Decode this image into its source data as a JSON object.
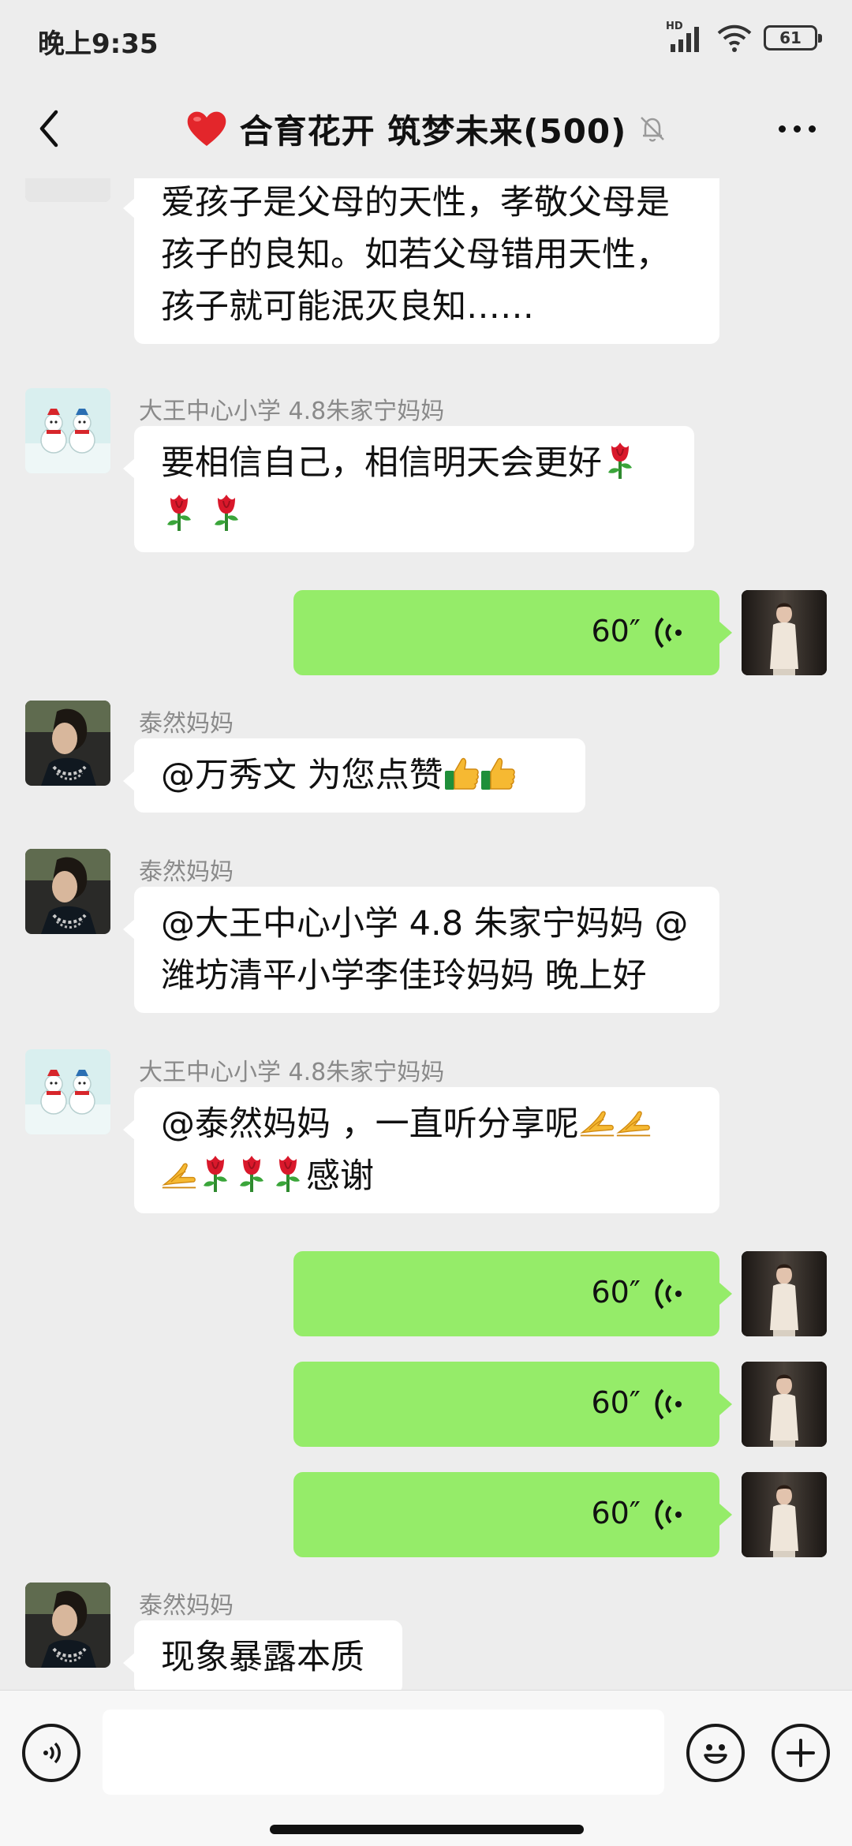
{
  "status_bar": {
    "time": "晚上9:35",
    "network": "HD",
    "battery": "61",
    "icons": [
      "signal-icon",
      "wifi-icon",
      "battery-icon"
    ]
  },
  "header": {
    "title": "合育花开 筑梦未来(500)",
    "title_emoji": "red-heart",
    "muted": true
  },
  "senders": {
    "a": "大王中心小学 4.8朱家宁妈妈",
    "b": "泰然妈妈"
  },
  "messages": [
    {
      "direction": "in",
      "lines": [
        "爱孩子是父母的天性，孝敬父母是",
        "孩子的良知。如若父母错用天性，",
        "孩子就可能泯灭良知……"
      ]
    },
    {
      "direction": "in",
      "sender": "大王中心小学 4.8朱家宁妈妈",
      "lines": [
        "要相信自己，相信明天会更好"
      ]
    },
    {
      "direction": "out",
      "type": "voice",
      "duration": "60″"
    },
    {
      "direction": "in",
      "sender": "泰然妈妈",
      "lines": [
        "@万秀文  为您点赞"
      ]
    },
    {
      "direction": "in",
      "sender": "泰然妈妈",
      "lines": [
        "@大王中心小学 4.8 朱家宁妈妈  @",
        "潍坊清平小学李佳玲妈妈  晚上好"
      ]
    },
    {
      "direction": "in",
      "sender": "大王中心小学 4.8朱家宁妈妈",
      "lines": [
        "@泰然妈妈 ，一直听分享呢",
        "感谢"
      ]
    },
    {
      "direction": "out",
      "type": "voice",
      "duration": "60″"
    },
    {
      "direction": "out",
      "type": "voice",
      "duration": "60″"
    },
    {
      "direction": "out",
      "type": "voice",
      "duration": "60″"
    },
    {
      "direction": "in",
      "sender": "泰然妈妈",
      "lines": [
        "现象暴露本质"
      ]
    }
  ],
  "input_bar": {
    "placeholder": "",
    "icons": [
      "voice-input-icon",
      "emoji-icon",
      "plus-icon"
    ]
  },
  "colors": {
    "background": "#ededed",
    "outgoing_bubble": "#95ec69",
    "incoming_bubble": "#ffffff",
    "sender_name": "#8a8a8a"
  }
}
